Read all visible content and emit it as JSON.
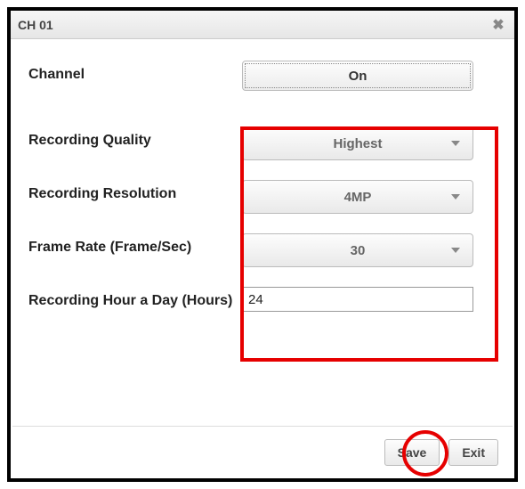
{
  "dialog": {
    "title": "CH 01",
    "close_glyph": "✖"
  },
  "fields": {
    "channel": {
      "label": "Channel",
      "value": "On"
    },
    "quality": {
      "label": "Recording Quality",
      "value": "Highest"
    },
    "resolution": {
      "label": "Recording Resolution",
      "value": "4MP"
    },
    "frame_rate": {
      "label": "Frame Rate (Frame/Sec)",
      "value": "30"
    },
    "hours": {
      "label": "Recording Hour a Day (Hours)",
      "value": "24"
    }
  },
  "footer": {
    "save_label": "Save",
    "exit_label": "Exit"
  }
}
